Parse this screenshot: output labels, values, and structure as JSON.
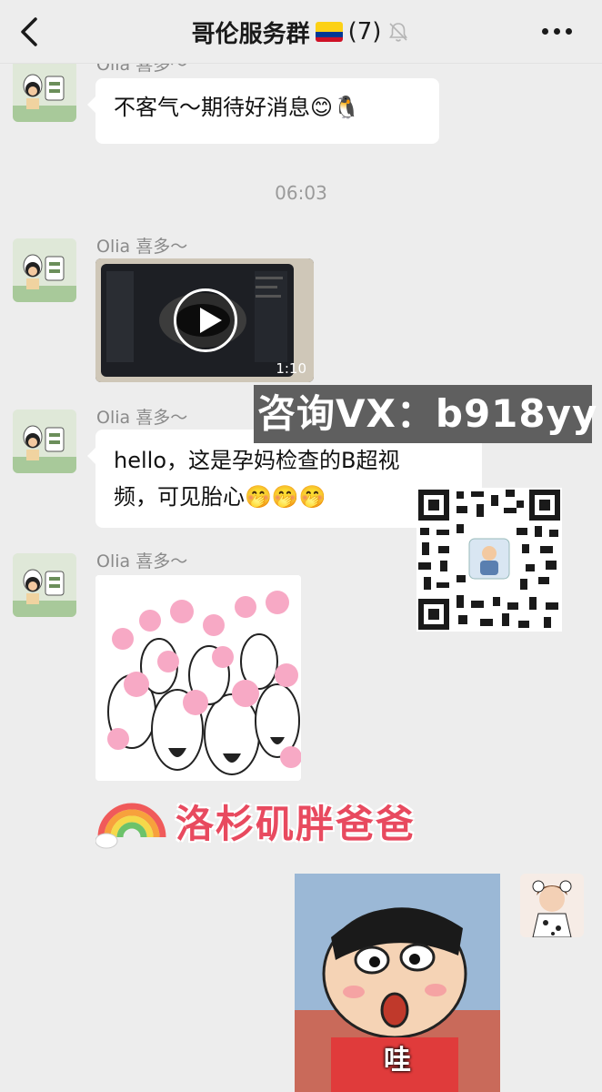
{
  "header": {
    "title": "哥伦服务群",
    "member_count": "(7)",
    "back_icon": "chevron-left-icon",
    "mute_icon": "bell-muted-icon",
    "more_icon": "more-dots-icon",
    "flag": {
      "name": "colombia-flag",
      "colors": [
        "#fcd116",
        "#003893",
        "#ce1126"
      ]
    }
  },
  "messages": [
    {
      "sender": "Olia 喜多～",
      "type": "text",
      "text": "不客气～期待好消息😊🐧"
    },
    {
      "timestamp": "06:03"
    },
    {
      "sender": "Olia 喜多～",
      "type": "video",
      "duration": "1:10"
    },
    {
      "sender": "Olia 喜多～",
      "type": "text",
      "text": "hello，这是孕妈检查的B超视频，可见胎心🤭🤭🤭",
      "lines": [
        "hello，这是孕妈检查的B超视",
        "频，可见胎心🤭🤭🤭"
      ]
    },
    {
      "sender": "Olia 喜多～",
      "type": "sticker",
      "sticker": "cheering-crowd-sticker"
    },
    {
      "type": "sticker",
      "sticker": "rainbow-sticker",
      "text": "洛杉矶胖爸爸"
    },
    {
      "type": "sticker",
      "sticker": "shinchan-sticker",
      "caption": "哇",
      "from": "self"
    }
  ],
  "overlay": {
    "watermark": "咨询VX：b918yy",
    "qr_icon": "qr-code-icon"
  },
  "colors": {
    "background": "#ededed",
    "bubble": "#ffffff",
    "sender": "#8a8a8a",
    "banner": "#e84a5f"
  }
}
